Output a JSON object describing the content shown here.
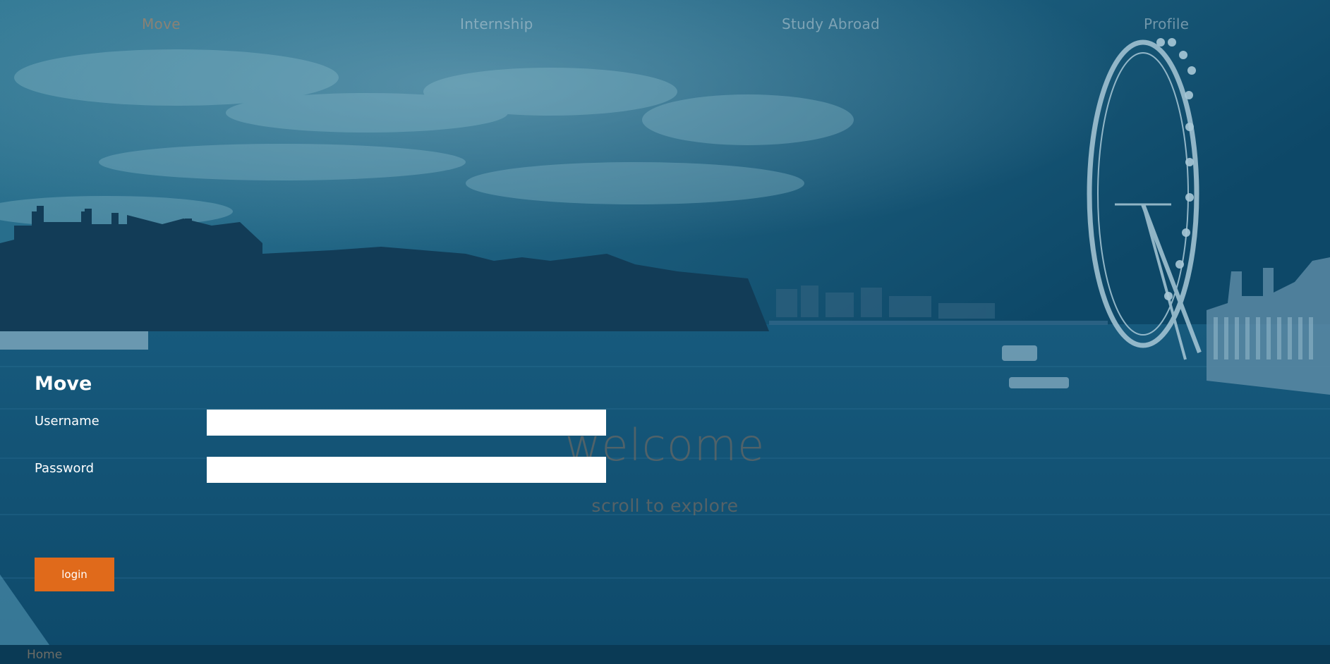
{
  "nav": {
    "items": [
      {
        "label": "Move",
        "active": true
      },
      {
        "label": "Internship",
        "active": false
      },
      {
        "label": "Study Abroad",
        "active": false
      },
      {
        "label": "Profile",
        "active": false
      }
    ]
  },
  "hero": {
    "welcome": "welcome",
    "scroll_hint": "scroll to explore",
    "background": "london-thames-skyline-photo"
  },
  "login": {
    "title": "Move",
    "username_label": "Username",
    "username_value": "",
    "password_label": "Password",
    "password_value": "",
    "submit_label": "login"
  },
  "footer": {
    "home_label": "Home"
  },
  "colors": {
    "overlay": "#0e4a6b",
    "button": "#e06a1b",
    "footer": "#0a3a55"
  }
}
